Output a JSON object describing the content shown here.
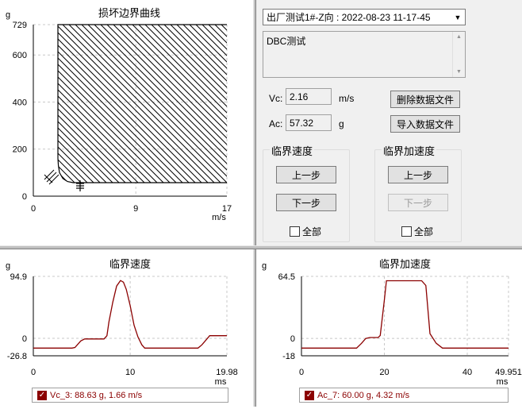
{
  "boundary_chart": {
    "title": "损坏边界曲线",
    "yunit": "g",
    "xunit": "m/s",
    "yticks": [
      "729",
      "600",
      "400",
      "200",
      "0"
    ],
    "xticks": [
      "0",
      "9",
      "17"
    ]
  },
  "panel": {
    "test_select": "出厂测试1#-Z向 : 2022-08-23 11-17-45",
    "memo_text": "DBC测试",
    "vc_label": "Vc:",
    "vc_value": "2.16",
    "vc_unit": "m/s",
    "ac_label": "Ac:",
    "ac_value": "57.32",
    "ac_unit": "g",
    "delete_button": "删除数据文件",
    "import_button": "导入数据文件",
    "velocity_group": {
      "title": "临界速度",
      "prev": "上一步",
      "next": "下一步",
      "all": "全部"
    },
    "accel_group": {
      "title": "临界加速度",
      "prev": "上一步",
      "next": "下一步",
      "all": "全部"
    }
  },
  "chart_data": [
    {
      "type": "area",
      "title": "损坏边界曲线",
      "ylabel": "g",
      "xlabel": "m/s",
      "xlim": [
        0,
        17
      ],
      "ylim": [
        0,
        729
      ],
      "critical_velocity": 2.16,
      "critical_acceleration": 57.32,
      "boundary": {
        "x": [
          17,
          4.3,
          3.5,
          3.0,
          2.6,
          2.3,
          2.2,
          2.16,
          2.16
        ],
        "y": [
          57.32,
          57.32,
          57.32,
          62,
          75,
          100,
          130,
          160,
          729
        ]
      }
    },
    {
      "type": "line",
      "title": "临界速度",
      "ylabel": "g",
      "xlabel": "ms",
      "xlim": [
        0,
        19.98
      ],
      "ylim": [
        -26.8,
        94.9
      ],
      "yticks": [
        "94.9",
        "0",
        "-26.8"
      ],
      "xticks": [
        "0",
        "10",
        "19.98"
      ],
      "series": [
        {
          "name": "Vc_3: 88.63 g, 1.66 m/s",
          "x": [
            0,
            4.0,
            4.3,
            4.9,
            5.3,
            7.3,
            7.6,
            7.8,
            8.2,
            8.6,
            9.0,
            9.3,
            9.6,
            10.0,
            10.4,
            10.8,
            11.2,
            11.5,
            11.8,
            17.0,
            17.4,
            17.8,
            18.2,
            19.98
          ],
          "y": [
            -15,
            -15,
            -14,
            -4,
            -1,
            -1,
            4,
            25,
            55,
            80,
            88.63,
            86,
            75,
            50,
            20,
            2,
            -10,
            -15,
            -15,
            -15,
            -10,
            -3,
            4,
            4
          ]
        }
      ]
    },
    {
      "type": "line",
      "title": "临界加速度",
      "ylabel": "g",
      "xlabel": "ms",
      "xlim": [
        0,
        49.951
      ],
      "ylim": [
        -18,
        64.5
      ],
      "yticks": [
        "64.5",
        "0",
        "-18"
      ],
      "xticks": [
        "0",
        "20",
        "40",
        "49.951"
      ],
      "series": [
        {
          "name": "Ac_7: 60.00 g, 4.32 m/s",
          "x": [
            0,
            13.3,
            14.5,
            15.5,
            16.5,
            18.5,
            19.0,
            20.0,
            20.5,
            22.0,
            29.0,
            30.0,
            31.0,
            32.5,
            34.0,
            34.5,
            49.951
          ],
          "y": [
            -10,
            -10,
            -5,
            0,
            1,
            1,
            3,
            40,
            60,
            60,
            60,
            55,
            5,
            -5,
            -10,
            -10,
            -10
          ]
        }
      ]
    }
  ]
}
